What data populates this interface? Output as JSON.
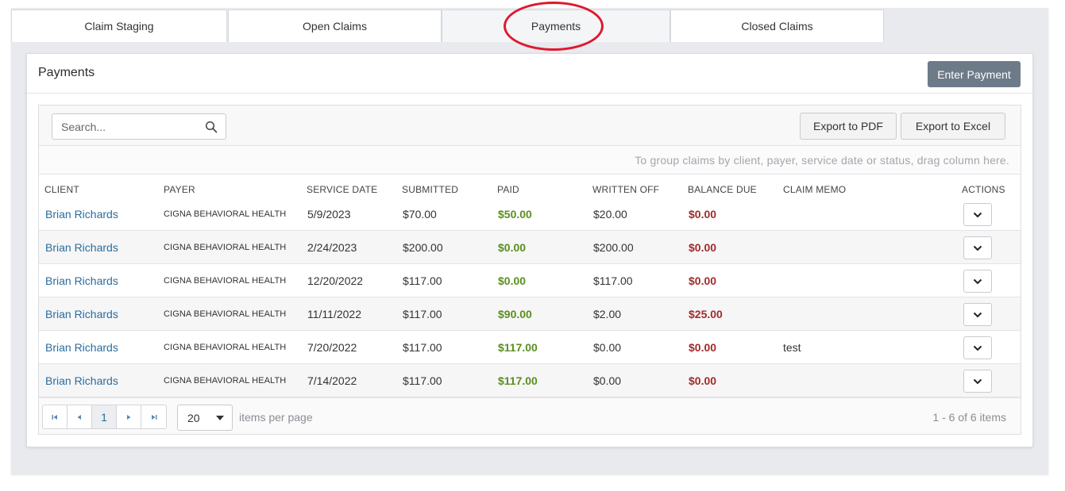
{
  "tabs": [
    {
      "label": "Claim Staging",
      "active": false
    },
    {
      "label": "Open Claims",
      "active": false
    },
    {
      "label": "Payments",
      "active": true
    },
    {
      "label": "Closed Claims",
      "active": false
    }
  ],
  "panel": {
    "title": "Payments",
    "enter_payment_label": "Enter Payment"
  },
  "toolbar": {
    "search_placeholder": "Search...",
    "export_pdf_label": "Export to PDF",
    "export_excel_label": "Export to Excel"
  },
  "group_hint": "To group claims by client, payer, service date or status, drag column here.",
  "columns": {
    "client": "CLIENT",
    "payer": "PAYER",
    "service_date": "SERVICE DATE",
    "submitted": "SUBMITTED",
    "paid": "PAID",
    "written_off": "WRITTEN OFF",
    "balance_due": "BALANCE DUE",
    "claim_memo": "CLAIM MEMO",
    "actions": "ACTIONS"
  },
  "rows": [
    {
      "client": "Brian Richards",
      "payer": "CIGNA BEHAVIORAL HEALTH",
      "service_date": "5/9/2023",
      "submitted": "$70.00",
      "paid": "$50.00",
      "written_off": "$20.00",
      "balance_due": "$0.00",
      "claim_memo": ""
    },
    {
      "client": "Brian Richards",
      "payer": "CIGNA BEHAVIORAL HEALTH",
      "service_date": "2/24/2023",
      "submitted": "$200.00",
      "paid": "$0.00",
      "written_off": "$200.00",
      "balance_due": "$0.00",
      "claim_memo": ""
    },
    {
      "client": "Brian Richards",
      "payer": "CIGNA BEHAVIORAL HEALTH",
      "service_date": "12/20/2022",
      "submitted": "$117.00",
      "paid": "$0.00",
      "written_off": "$117.00",
      "balance_due": "$0.00",
      "claim_memo": ""
    },
    {
      "client": "Brian Richards",
      "payer": "CIGNA BEHAVIORAL HEALTH",
      "service_date": "11/11/2022",
      "submitted": "$117.00",
      "paid": "$90.00",
      "written_off": "$2.00",
      "balance_due": "$25.00",
      "claim_memo": ""
    },
    {
      "client": "Brian Richards",
      "payer": "CIGNA BEHAVIORAL HEALTH",
      "service_date": "7/20/2022",
      "submitted": "$117.00",
      "paid": "$117.00",
      "written_off": "$0.00",
      "balance_due": "$0.00",
      "claim_memo": "test"
    },
    {
      "client": "Brian Richards",
      "payer": "CIGNA BEHAVIORAL HEALTH",
      "service_date": "7/14/2022",
      "submitted": "$117.00",
      "paid": "$117.00",
      "written_off": "$0.00",
      "balance_due": "$0.00",
      "claim_memo": ""
    }
  ],
  "pager": {
    "current_page": "1",
    "per_page": "20",
    "per_page_label": "items per page",
    "items_count": "1 - 6 of 6 items"
  },
  "icons": {
    "search": "search-icon",
    "row_action": "chevron-down-icon",
    "first": "first-page-icon",
    "prev": "prev-page-icon",
    "next": "next-page-icon",
    "last": "last-page-icon"
  },
  "colors": {
    "paid": "#5a8f1f",
    "balance_due": "#a12b2b",
    "client_link": "#2a6d9e",
    "enter_button": "#6d7a88",
    "highlight": "#e0182d"
  }
}
